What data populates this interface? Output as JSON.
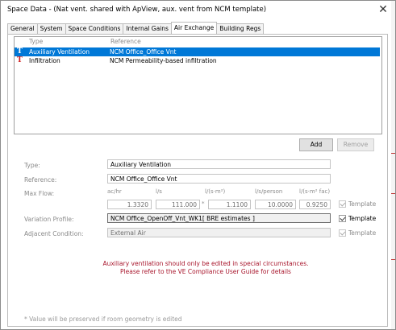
{
  "window": {
    "title": "Space Data - (Nat vent. shared with ApView, aux. vent from NCM template)",
    "close_glyph": "✕"
  },
  "tabs": [
    {
      "label": "General",
      "active": false
    },
    {
      "label": "System",
      "active": false
    },
    {
      "label": "Space Conditions",
      "active": false
    },
    {
      "label": "Internal Gains",
      "active": false
    },
    {
      "label": "Air Exchange",
      "active": true
    },
    {
      "label": "Building Regs",
      "active": false
    }
  ],
  "list": {
    "headers": {
      "type": "Type",
      "reference": "Reference"
    },
    "rows": [
      {
        "icon": "T",
        "type": "Auxiliary Ventilation",
        "reference": "NCM Office_Office Vnt",
        "selected": true
      },
      {
        "icon": "T",
        "type": "Infiltration",
        "reference": "NCM Permeability-based infiltration",
        "selected": false
      }
    ]
  },
  "buttons": {
    "add": "Add",
    "remove": "Remove"
  },
  "form": {
    "type_label": "Type:",
    "type_value": "Auxiliary Ventilation",
    "reference_label": "Reference:",
    "reference_value": "NCM Office_Office Vnt",
    "maxflow_label": "Max Flow:",
    "units": [
      "ac/hr",
      "l/s",
      "l/(s·m²)",
      "l/s/person",
      "l/(s·m² fac)"
    ],
    "values": [
      "1.3320",
      "111.000",
      "1.1100",
      "10.0000",
      "0.9250"
    ],
    "star": "*",
    "template_label": "Template",
    "maxflow_template_checked": true,
    "variation_label": "Variation Profile:",
    "variation_value": "NCM Office_OpenOff_Vnt_WK1[ BRE estimates ]",
    "variation_template_checked": true,
    "adjacent_label": "Adjacent Condition:",
    "adjacent_value": "External Air",
    "adjacent_template_checked": true
  },
  "warning": {
    "line1": "Auxiliary ventilation should only be edited in special circumstances.",
    "line2": "Please refer to the VE Compliance User Guide for details"
  },
  "footnote": "* Value will be preserved if room geometry is edited",
  "colors": {
    "selection": "#0078d7",
    "warning": "#a8162c",
    "icon_red": "#d01e1e"
  }
}
